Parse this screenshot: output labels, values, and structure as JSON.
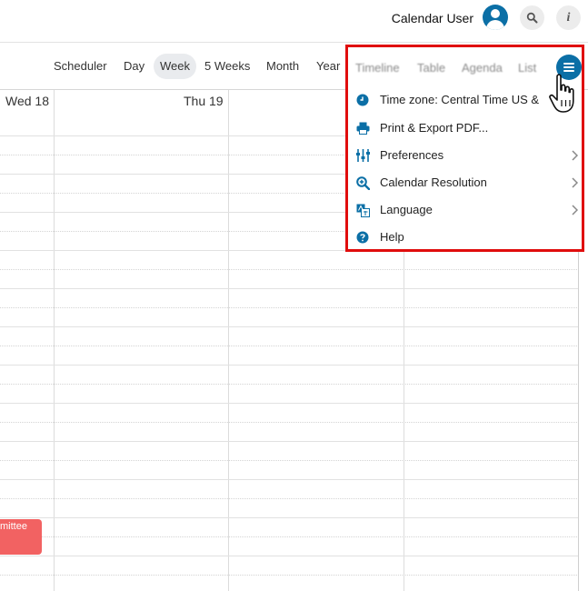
{
  "header": {
    "user_name": "Calendar User",
    "icons": [
      "user-avatar-icon",
      "search-icon",
      "info-icon"
    ]
  },
  "views": {
    "tabs": [
      {
        "label": "Scheduler"
      },
      {
        "label": "Day"
      },
      {
        "label": "Week",
        "active": true
      },
      {
        "label": "5 Weeks"
      },
      {
        "label": "Month"
      },
      {
        "label": "Year"
      }
    ],
    "extra_tabs": [
      "Timeline",
      "Table",
      "Agenda",
      "List"
    ]
  },
  "calendar": {
    "days": [
      {
        "label": "Wed 18"
      },
      {
        "label": "Thu 19"
      }
    ],
    "event": {
      "label": "mittee",
      "color": "#f26262"
    }
  },
  "menu": {
    "items": [
      {
        "label": "Time zone: Central Time US &",
        "icon": "clock-icon",
        "has_submenu": false
      },
      {
        "label": "Print & Export PDF...",
        "icon": "printer-icon",
        "has_submenu": false
      },
      {
        "label": "Preferences",
        "icon": "sliders-icon",
        "has_submenu": true
      },
      {
        "label": "Calendar Resolution",
        "icon": "zoom-icon",
        "has_submenu": true
      },
      {
        "label": "Language",
        "icon": "translate-icon",
        "has_submenu": true
      },
      {
        "label": "Help",
        "icon": "help-icon",
        "has_submenu": false
      }
    ]
  },
  "colors": {
    "accent": "#0b6fa6",
    "highlight": "#e00d0d",
    "event": "#f26262"
  }
}
